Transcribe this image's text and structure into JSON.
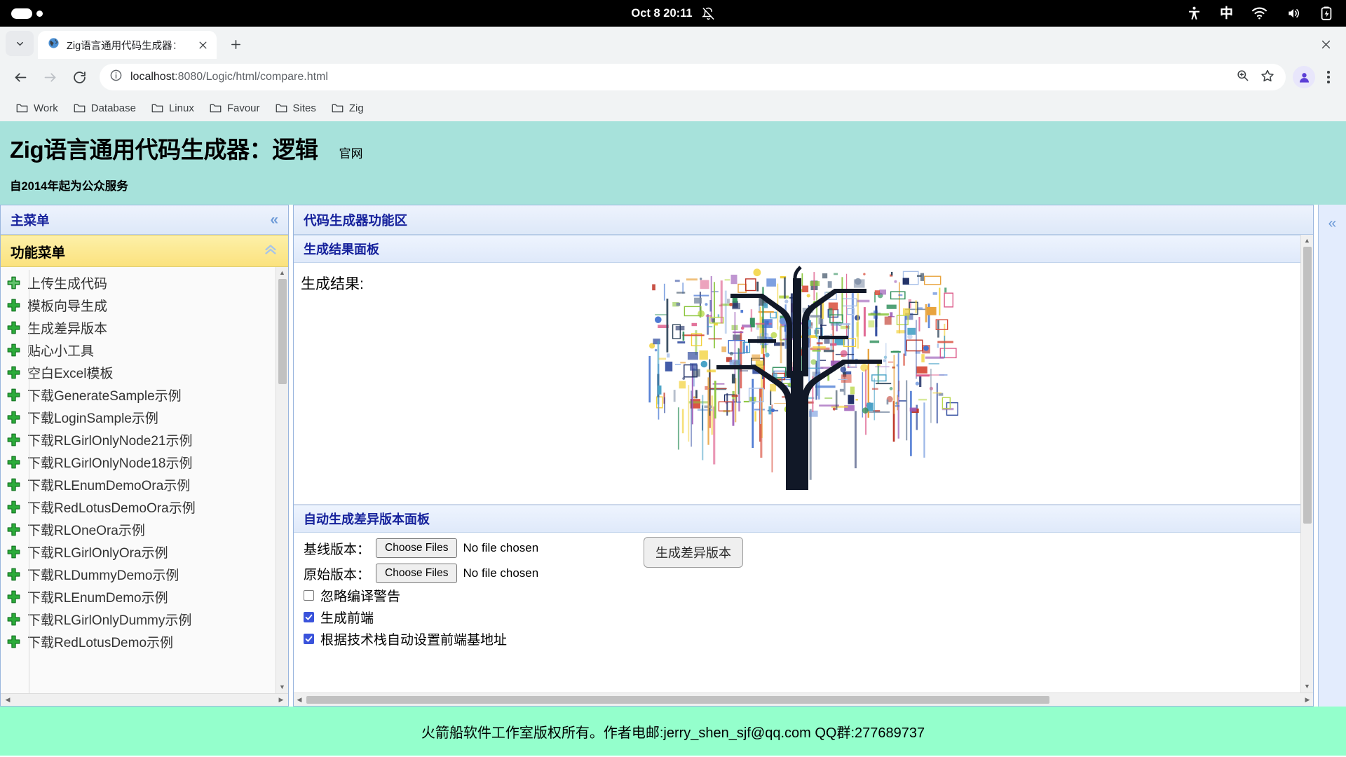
{
  "os_bar": {
    "datetime": "Oct 8  20:11",
    "tray": [
      {
        "name": "notifications-muted-icon"
      },
      {
        "name": "accessibility-icon"
      },
      {
        "name": "input-method-icon",
        "label": "中"
      },
      {
        "name": "wifi-icon"
      },
      {
        "name": "volume-icon"
      },
      {
        "name": "battery-charging-icon"
      }
    ]
  },
  "browser": {
    "tab": {
      "title": "Zig语言通用代码生成器：",
      "close_label": "×"
    },
    "new_tab_label": "+",
    "window_close_label": "×",
    "omnibox": {
      "host": "localhost",
      "path": ":8080/Logic/html/compare.html"
    },
    "bookmarks": [
      {
        "label": "Work"
      },
      {
        "label": "Database"
      },
      {
        "label": "Linux"
      },
      {
        "label": "Favour"
      },
      {
        "label": "Sites"
      },
      {
        "label": "Zig"
      }
    ]
  },
  "page": {
    "title": "Zig语言通用代码生成器：逻辑",
    "official_link": "官网",
    "subtitle": "自2014年起为公众服务",
    "header_bg": "#a7e2db",
    "footer_bg": "#94ffcc",
    "accent_blue": "#16229c"
  },
  "sidebar": {
    "main_menu_title": "主菜单",
    "main_menu_collapse": "«",
    "function_menu_title": "功能菜单",
    "function_menu_collapse": "«",
    "items": [
      {
        "label": "上传生成代码"
      },
      {
        "label": "模板向导生成"
      },
      {
        "label": "生成差异版本"
      },
      {
        "label": "贴心小工具"
      },
      {
        "label": "空白Excel模板"
      },
      {
        "label": "下载GenerateSample示例"
      },
      {
        "label": "下载LoginSample示例"
      },
      {
        "label": "下载RLGirlOnlyNode21示例"
      },
      {
        "label": "下载RLGirlOnlyNode18示例"
      },
      {
        "label": "下载RLEnumDemoOra示例"
      },
      {
        "label": "下载RedLotusDemoOra示例"
      },
      {
        "label": "下载RLOneOra示例"
      },
      {
        "label": "下载RLGirlOnlyOra示例"
      },
      {
        "label": "下载RLDummyDemo示例"
      },
      {
        "label": "下载RLEnumDemo示例"
      },
      {
        "label": "下载RLGirlOnlyDummy示例"
      },
      {
        "label": "下载RedLotusDemo示例"
      }
    ]
  },
  "main": {
    "toolbar_title": "代码生成器功能区",
    "result_panel_title": "生成结果面板",
    "result_label": "生成结果:",
    "diff_panel_title": "自动生成差异版本面板",
    "baseline_label": "基线版本：",
    "original_label": "原始版本：",
    "choose_files_label": "Choose Files",
    "no_file_label": "No file chosen",
    "generate_diff_button": "生成差异版本",
    "checkboxes": [
      {
        "label": "忽略编译警告",
        "checked": false
      },
      {
        "label": "生成前端",
        "checked": true
      },
      {
        "label": "根据技术栈自动设置前端基地址",
        "checked": true
      }
    ]
  },
  "right_rail": {
    "collapse_label": "«"
  },
  "footer": {
    "text": "火箭船软件工作室版权所有。作者电邮:jerry_shen_sjf@qq.com QQ群:277689737"
  }
}
